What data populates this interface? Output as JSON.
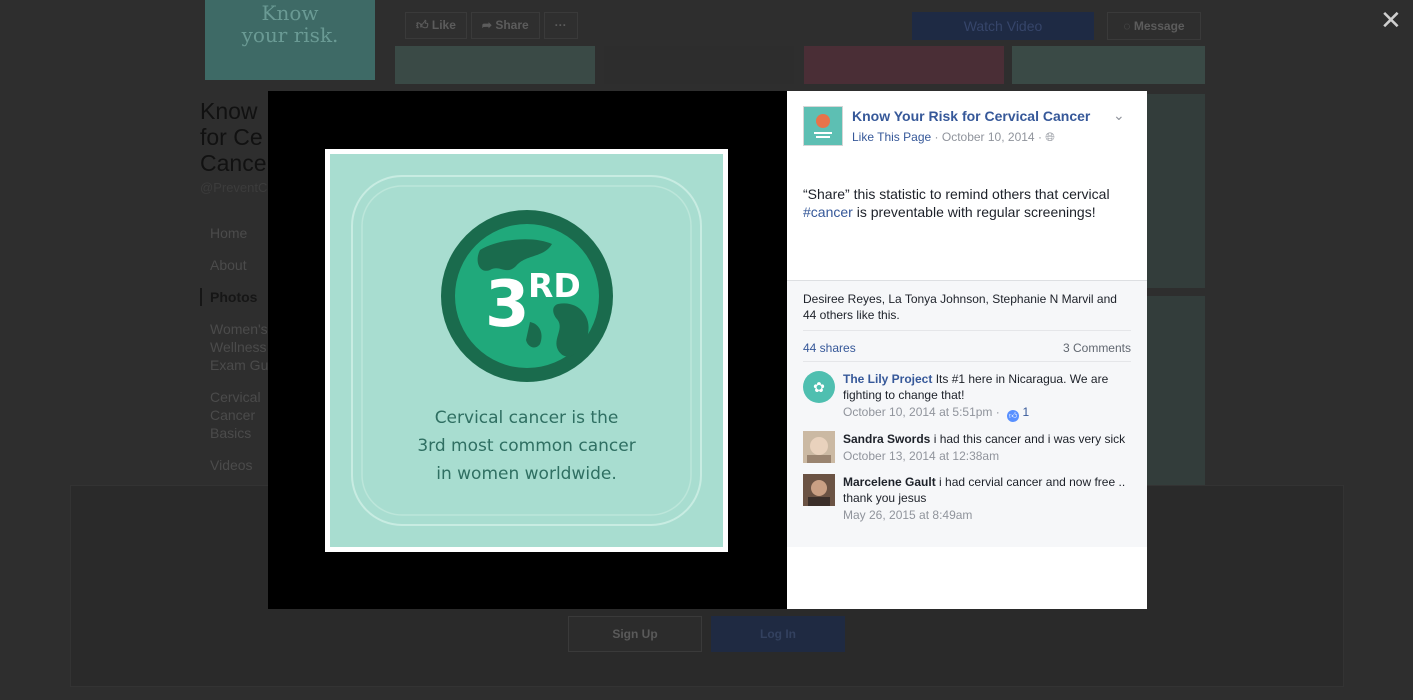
{
  "background": {
    "logo_text": "Know\nyour risk.",
    "like_label": "Like",
    "share_label": "Share",
    "more_label": "···",
    "watch_video": "Watch Video",
    "message": "Message",
    "title_lines": [
      "Know",
      "for Ce",
      "Cance"
    ],
    "handle": "@PreventC",
    "nav": [
      "Home",
      "About",
      "Photos",
      "Women's Wellness Exam Gu",
      "Cervical Cancer Basics",
      "Videos"
    ],
    "sign_up": "Sign Up",
    "log_in": "Log In"
  },
  "lightbox": {
    "close_glyph": "✕",
    "photo": {
      "badge": "3",
      "badge_suffix": "RD",
      "caption": [
        "Cervical cancer is the",
        "3rd most common cancer",
        "in women worldwide."
      ],
      "colors": {
        "background": "#a8ddd0",
        "globe_dark": "#1a6b4d",
        "globe_light": "#20a97b"
      }
    },
    "post": {
      "page_name": "Know Your Risk for Cervical Cancer",
      "like_this_page": "Like This Page",
      "date": "October 10, 2014",
      "text_before": "“Share” this statistic to remind others that cervical ",
      "hashtag": "#cancer",
      "text_after": " is preventable with regular screenings!",
      "likers": "Desiree Reyes, La Tonya Johnson, Stephanie N Marvil and 44 others like this.",
      "shares": "44 shares",
      "comments_count": "3 Comments"
    },
    "comments": [
      {
        "author": "The Lily Project",
        "text": "Its #1 here in Nicaragua. We are fighting to change that!",
        "time": "October 10, 2014 at 5:51pm",
        "likes": "1"
      },
      {
        "author": "Sandra Swords",
        "text": "i had this cancer and i was very sick",
        "time": "October 13, 2014 at 12:38am"
      },
      {
        "author": "Marcelene Gault",
        "text": "i had cervial cancer and now free .. thank you jesus",
        "time": "May 26, 2015 at 8:49am"
      }
    ]
  }
}
